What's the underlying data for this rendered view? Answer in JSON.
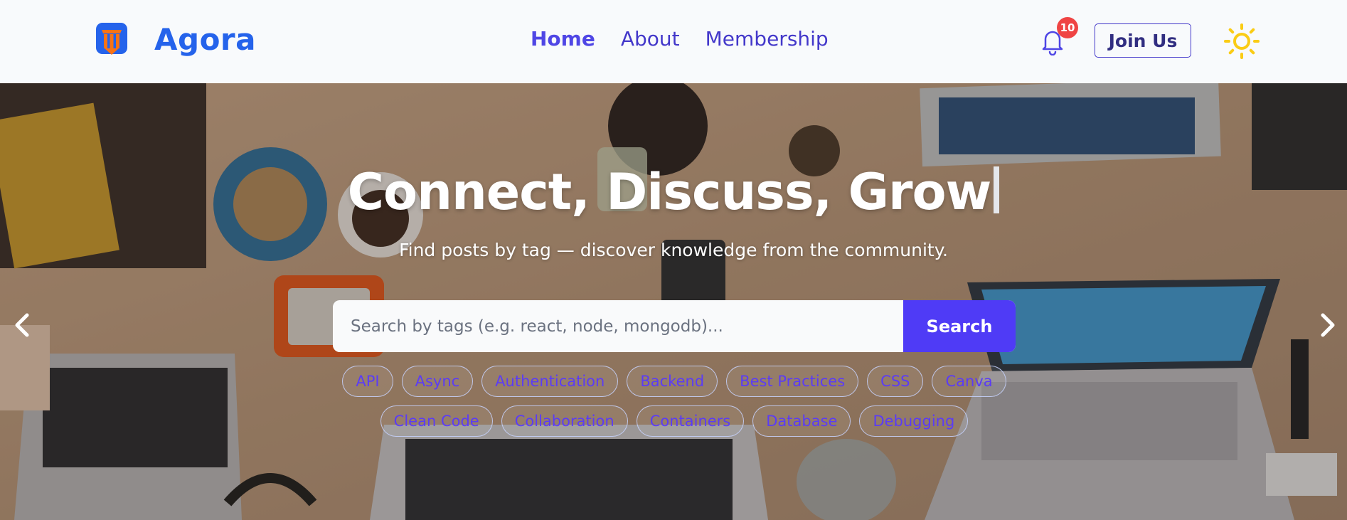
{
  "brand": {
    "name": "Agora"
  },
  "nav": {
    "links": [
      {
        "label": "Home",
        "active": true
      },
      {
        "label": "About",
        "active": false
      },
      {
        "label": "Membership",
        "active": false
      }
    ]
  },
  "notifications": {
    "count": "10",
    "icon": "bell-icon"
  },
  "actions": {
    "join_label": "Join Us",
    "theme_icon": "sun-icon"
  },
  "hero": {
    "title": "Connect, Discuss, Grow",
    "subtitle": "Find posts by tag — discover knowledge from the community.",
    "search": {
      "placeholder": "Search by tags (e.g. react, node, mongodb)...",
      "value": "",
      "button_label": "Search"
    },
    "tags": [
      "API",
      "Async",
      "Authentication",
      "Backend",
      "Best Practices",
      "CSS",
      "Canva",
      "Clean Code",
      "Collaboration",
      "Containers",
      "Database",
      "Debugging"
    ]
  },
  "colors": {
    "brand": "#2563eb",
    "accent": "#4f3bf6",
    "nav_link": "#4338ca",
    "badge": "#ef4444",
    "sun": "#facc15"
  }
}
